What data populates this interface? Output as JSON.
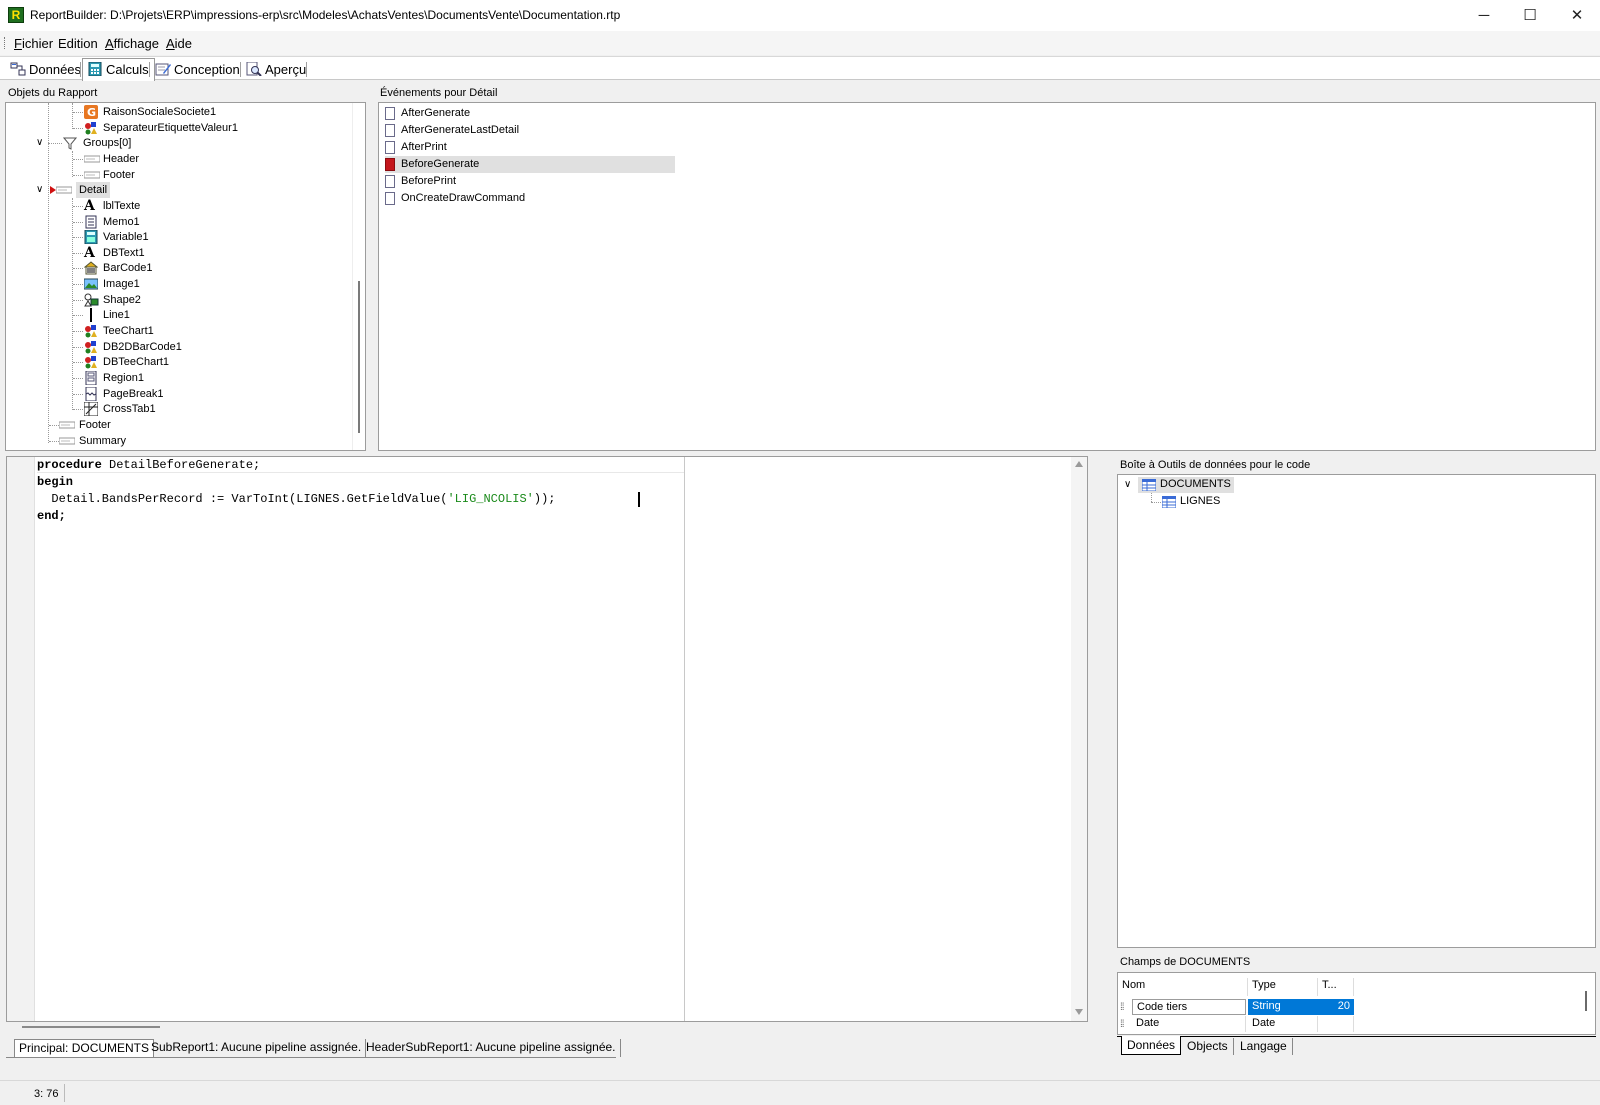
{
  "window": {
    "title": "ReportBuilder: D:\\Projets\\ERP\\impressions-erp\\src\\Modeles\\AchatsVentes\\DocumentsVente\\Documentation.rtp",
    "app_icon_letter": "R",
    "minimize_glyph": "─",
    "maximize_glyph": "☐",
    "close_glyph": "✕"
  },
  "menu": [
    {
      "accel": "F",
      "rest": "ichier"
    },
    {
      "accel": "",
      "rest": "Edition"
    },
    {
      "accel": "A",
      "rest": "ffichage"
    },
    {
      "accel": "A",
      "rest": "ide"
    }
  ],
  "tabs": [
    {
      "label": "Données",
      "icon": "data-icon",
      "active": false
    },
    {
      "label": "Calculs",
      "icon": "calc-icon",
      "active": true
    },
    {
      "label": "Conception",
      "icon": "design-icon",
      "active": false
    },
    {
      "label": "Aperçu",
      "icon": "preview-icon",
      "active": false
    }
  ],
  "report_tree": {
    "label": "Objets du Rapport",
    "items": [
      {
        "label": "RaisonSocialeSociete1",
        "icon": "orange-g-icon"
      },
      {
        "label": "SeparateurEtiquetteValeur1",
        "icon": "shapes-icon"
      },
      {
        "label": "Groups[0]",
        "icon": "groups-icon",
        "expand": "v"
      },
      {
        "label": "Header",
        "icon": "band-icon"
      },
      {
        "label": "Footer",
        "icon": "band-icon"
      },
      {
        "label": "Detail",
        "icon": "band-icon",
        "expand": "v",
        "selected": true
      },
      {
        "label": "lblTexte",
        "icon": "label-icon"
      },
      {
        "label": "Memo1",
        "icon": "memo-icon"
      },
      {
        "label": "Variable1",
        "icon": "variable-icon"
      },
      {
        "label": "DBText1",
        "icon": "dbtext-icon"
      },
      {
        "label": "BarCode1",
        "icon": "barcode-icon"
      },
      {
        "label": "Image1",
        "icon": "image-icon"
      },
      {
        "label": "Shape2",
        "icon": "shape-icon"
      },
      {
        "label": "Line1",
        "icon": "line-icon"
      },
      {
        "label": "TeeChart1",
        "icon": "shapes-icon"
      },
      {
        "label": "DB2DBarCode1",
        "icon": "shapes-icon"
      },
      {
        "label": "DBTeeChart1",
        "icon": "shapes-icon"
      },
      {
        "label": "Region1",
        "icon": "region-icon"
      },
      {
        "label": "PageBreak1",
        "icon": "pagebreak-icon"
      },
      {
        "label": "CrossTab1",
        "icon": "crosstab-icon"
      },
      {
        "label": "Footer",
        "icon": "band-icon"
      },
      {
        "label": "Summary",
        "icon": "band-icon"
      }
    ]
  },
  "events": {
    "label": "Événements pour Détail",
    "items": [
      {
        "label": "AfterGenerate",
        "has_code": false
      },
      {
        "label": "AfterGenerateLastDetail",
        "has_code": false
      },
      {
        "label": "AfterPrint",
        "has_code": false
      },
      {
        "label": "BeforeGenerate",
        "has_code": true
      },
      {
        "label": "BeforePrint",
        "has_code": false
      },
      {
        "label": "OnCreateDrawCommand",
        "has_code": false
      }
    ]
  },
  "code": {
    "line1_kw": "procedure",
    "line1_rest": " DetailBeforeGenerate;",
    "line2_kw": "begin",
    "line3_pre": "  Detail.BandsPerRecord := VarToInt(LIGNES.GetFieldValue(",
    "line3_str": "'LIG_NCOLIS'",
    "line3_post": "));",
    "line4_kw": "end;"
  },
  "toolbox": {
    "label": "Boîte à Outils de données pour le code",
    "root": "DOCUMENTS",
    "child": "LIGNES"
  },
  "fields": {
    "label": "Champs de DOCUMENTS",
    "columns": [
      "Nom",
      "Type",
      "T..."
    ],
    "rows": [
      {
        "name": "Code tiers",
        "type": "String",
        "size": "20",
        "selected": true
      },
      {
        "name": "Date",
        "type": "Date",
        "size": "",
        "selected": false
      }
    ],
    "tabs": [
      "Données",
      "Objects",
      "Langage"
    ]
  },
  "pipeline_tabs": [
    "Principal: DOCUMENTS",
    "SubReport1: Aucune pipeline assignée.",
    "HeaderSubReport1: Aucune pipeline assignée."
  ],
  "status": {
    "cursor": "3: 76"
  },
  "colors": {
    "selection": "#0078d7",
    "code_string": "#1a8a1a",
    "event_selected_bg": "#e0e0e0"
  }
}
